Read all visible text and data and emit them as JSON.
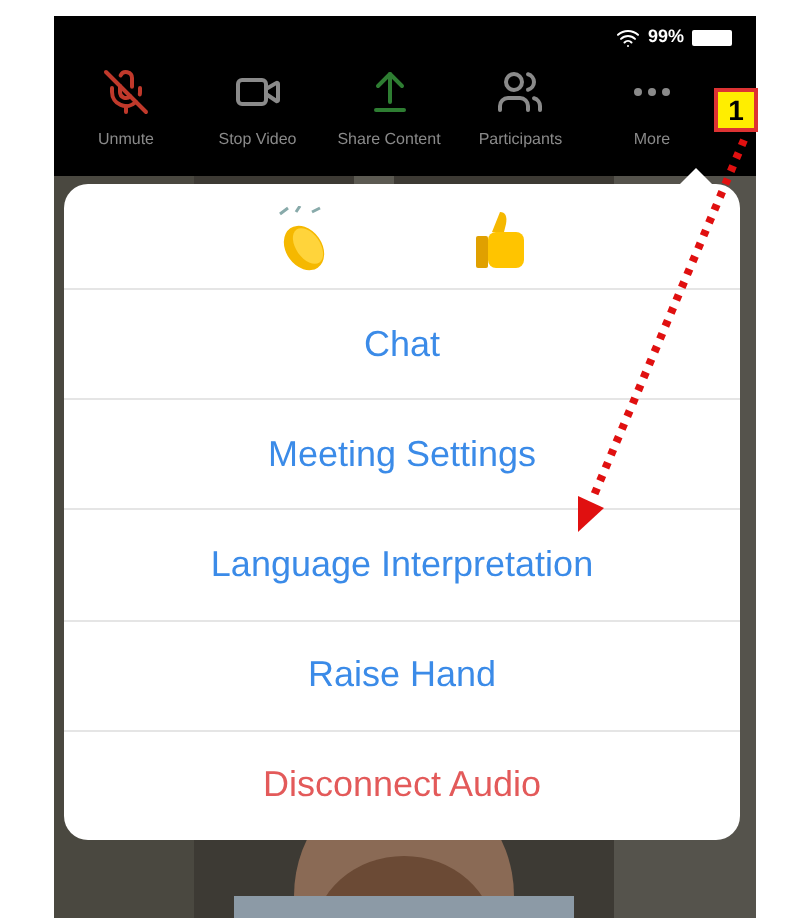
{
  "status_bar": {
    "battery": "99%"
  },
  "toolbar": [
    {
      "kind": "mute",
      "label": "Unmute"
    },
    {
      "kind": "video",
      "label": "Stop Video"
    },
    {
      "kind": "share",
      "label": "Share Content"
    },
    {
      "kind": "participants",
      "label": "Participants"
    },
    {
      "kind": "more",
      "label": "More"
    }
  ],
  "menu": {
    "items": [
      {
        "label": "Chat",
        "kind": "normal"
      },
      {
        "label": "Meeting Settings",
        "kind": "normal"
      },
      {
        "label": "Language Interpretation",
        "kind": "normal"
      },
      {
        "label": "Raise Hand",
        "kind": "normal"
      },
      {
        "label": "Disconnect Audio",
        "kind": "destructive"
      }
    ]
  },
  "annotation": {
    "label": "1"
  }
}
